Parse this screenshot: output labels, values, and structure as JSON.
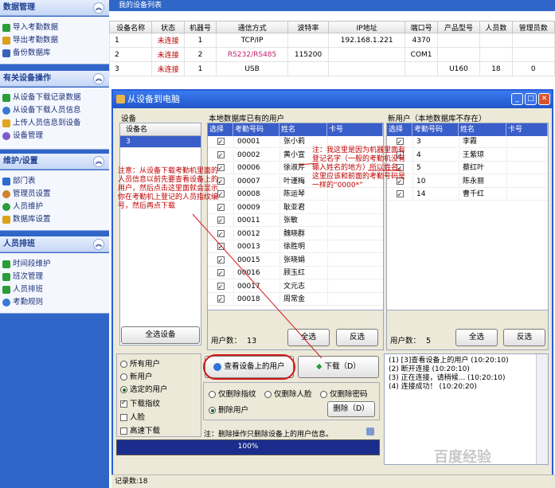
{
  "nav": {
    "groups": [
      {
        "title": "数据管理",
        "items": [
          "导入考勤数据",
          "导出考勤数据",
          "备份数据库"
        ]
      },
      {
        "title": "有关设备操作",
        "items": [
          "从设备下载记录数据",
          "从设备下载人员信息",
          "上传人员信息到设备",
          "设备管理"
        ]
      },
      {
        "title": "维护/设置",
        "items": [
          "部门表",
          "管理员设置",
          "人员维护",
          "数据库设置"
        ]
      },
      {
        "title": "人员排班",
        "items": [
          "时间段维护",
          "班次管理",
          "人员排班",
          "考勤规则"
        ]
      }
    ]
  },
  "top": {
    "title": "我的设备列表"
  },
  "device_table": {
    "columns": [
      "设备名称",
      "状态",
      "机器号",
      "通信方式",
      "波特率",
      "IP地址",
      "端口号",
      "产品型号",
      "人员数",
      "管理员数"
    ],
    "rows": [
      [
        "1",
        "未连接",
        "1",
        "TCP/IP",
        "",
        "192.168.1.221",
        "4370",
        "",
        "",
        ""
      ],
      [
        "2",
        "未连接",
        "2",
        "RS232/RS485",
        "115200",
        "",
        "COM1",
        "",
        "",
        ""
      ],
      [
        "3",
        "未连接",
        "1",
        "USB",
        "",
        "",
        "",
        "U160",
        "18",
        "0"
      ]
    ]
  },
  "dialog": {
    "title": "从设备到电脑",
    "device_panel": {
      "label": "设备",
      "column": "设备名",
      "items": [
        "3"
      ],
      "select_all": "全选设备"
    },
    "existing_panel": {
      "label": "本地数据库已有的用户",
      "columns": [
        "选择",
        "考勤号码",
        "姓名",
        "卡号"
      ],
      "rows": [
        [
          "00001",
          "张小莉"
        ],
        [
          "00002",
          "黄小宣"
        ],
        [
          "00006",
          "徐淑芹"
        ],
        [
          "00007",
          "叶谨梅"
        ],
        [
          "00008",
          "陈运琴"
        ],
        [
          "00009",
          "耿亚君"
        ],
        [
          "00011",
          "张敏"
        ],
        [
          "00012",
          "魏晓群"
        ],
        [
          "00013",
          "徐胜明"
        ],
        [
          "00015",
          "张晓娟"
        ],
        [
          "00016",
          "顾玉红"
        ],
        [
          "00017",
          "文元志"
        ],
        [
          "00018",
          "周常金"
        ]
      ],
      "count_label": "用户数：",
      "count": "13",
      "select_all": "全选",
      "invert": "反选"
    },
    "new_panel": {
      "label": "新用户（本地数据库不存在）",
      "columns": [
        "选择",
        "考勤号码",
        "姓名",
        "卡号"
      ],
      "rows": [
        [
          "3",
          "李霞"
        ],
        [
          "4",
          "王紫琼"
        ],
        [
          "5",
          "蔡红叶"
        ],
        [
          "10",
          "陈永丽"
        ],
        [
          "14",
          "曹千红"
        ]
      ],
      "count_label": "用户数：",
      "count": "5",
      "select_all": "全选",
      "invert": "反选"
    },
    "user_options": [
      "所有用户",
      "新用户",
      "选定的用户"
    ],
    "checks": [
      "下载指纹",
      "人脸",
      "高速下载"
    ],
    "view_button": "查看设备上的用户",
    "download_button": "下载（D）",
    "delete_options": [
      "仅删除指纹",
      "仅删除人脸",
      "仅删除密码",
      "删除用户"
    ],
    "delete_button": "删除（D）",
    "delete_note": "注：删除操作只删除设备上的用户信息。",
    "log": [
      "(1) [3]查看设备上的用户 (10:20:10)",
      "(2) 断开连接 (10:20:10)",
      "(3) 正在连接，请稍候... (10:20:10)",
      "(4) 连接成功！ (10:20:20)"
    ],
    "progress_text": "100%",
    "progress_value": 100,
    "annotation_left": "注意：从设备下载考勤机里面的人员信息以前先要查看设备上的用户，然后点击这里面就会显示你在考勤机上登记的人员指纹编号，然后再点下载",
    "annotation_right": "注：我这里是因为机器里面有登记名字（一般的考勤机没有输入姓名的地方）所以姓名。这里应该和前面的考勤号码是一样的“0000*”"
  },
  "status": {
    "records": "记录数:18"
  },
  "watermark": "百度经验",
  "colors": {
    "nav_bg": "#2f66c8",
    "title_bar": "#1f56c9",
    "grid_header": "#3a5ec9",
    "progress": "#1b2d8c",
    "annotation": "#c00000"
  }
}
